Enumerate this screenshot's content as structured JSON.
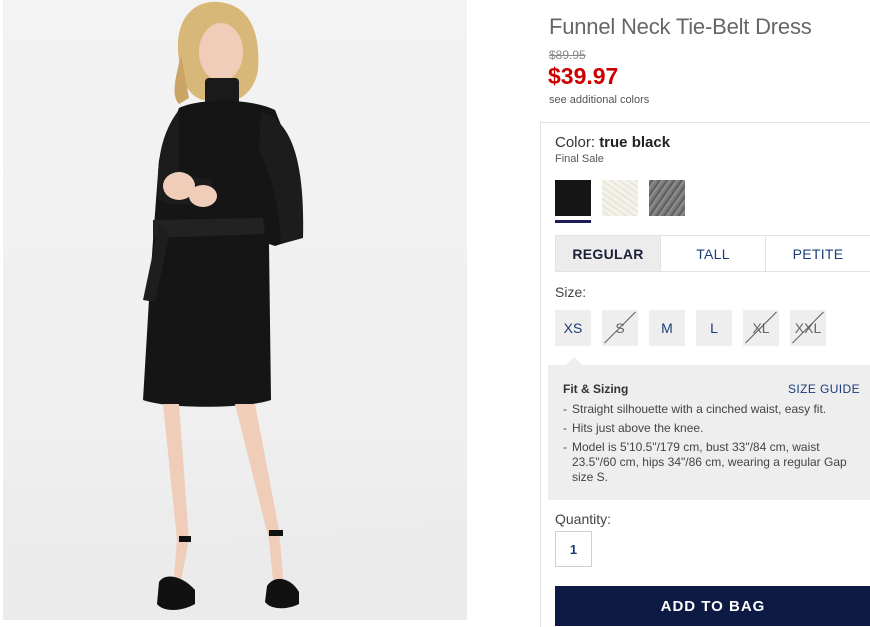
{
  "product": {
    "title": "Funnel Neck Tie-Belt Dress",
    "original_price": "$89.95",
    "sale_price": "$39.97",
    "sale_color": "#cc0000",
    "see_colors": "see additional colors"
  },
  "color": {
    "label": "Color:",
    "selected": "true black",
    "note": "Final Sale",
    "swatches": [
      {
        "name": "true black",
        "hex": "#151515",
        "selected": true
      },
      {
        "name": "ivory",
        "hex": "#f1efe6",
        "selected": false
      },
      {
        "name": "heather gray",
        "hex": "#6f6f6f",
        "selected": false
      }
    ]
  },
  "fit_tabs": [
    {
      "label": "REGULAR",
      "active": true
    },
    {
      "label": "TALL",
      "active": false
    },
    {
      "label": "PETITE",
      "active": false
    }
  ],
  "size": {
    "label": "Size:",
    "options": [
      {
        "label": "XS",
        "available": true
      },
      {
        "label": "S",
        "available": false
      },
      {
        "label": "M",
        "available": true
      },
      {
        "label": "L",
        "available": true
      },
      {
        "label": "XL",
        "available": false
      },
      {
        "label": "XXL",
        "available": false
      }
    ]
  },
  "fit_sizing": {
    "heading": "Fit & Sizing",
    "guide_link": "SIZE GUIDE",
    "bullets": [
      "Straight silhouette with a cinched waist, easy fit.",
      "Hits just above the knee.",
      "Model is 5'10.5\"/179 cm, bust 33\"/84 cm, waist 23.5\"/60 cm, hips 34\"/86 cm, wearing a regular Gap size S."
    ]
  },
  "quantity": {
    "label": "Quantity:",
    "value": "1"
  },
  "cta": {
    "add_to_bag": "ADD TO BAG",
    "color": "#0d1a44"
  }
}
